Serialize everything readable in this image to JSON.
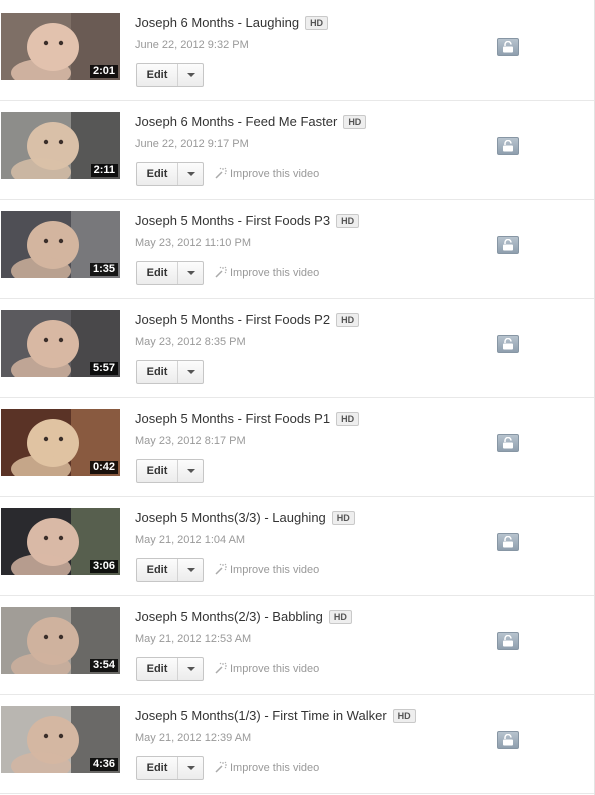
{
  "videos": [
    {
      "title": "Joseph 6 Months - Laughing",
      "hd": "HD",
      "date": "June 22, 2012 9:32 PM",
      "duration": "2:01",
      "edit_label": "Edit",
      "improve_label": "",
      "thumb_colors": {
        "bg": "#7e6f66",
        "fg": "#e2c2ae",
        "accent": "#5a4a45"
      },
      "privacy_icon": "unlock-icon"
    },
    {
      "title": "Joseph 6 Months - Feed Me Faster",
      "hd": "HD",
      "date": "June 22, 2012 9:17 PM",
      "duration": "2:11",
      "edit_label": "Edit",
      "improve_label": "Improve this video",
      "thumb_colors": {
        "bg": "#8d8d8a",
        "fg": "#d9c0a8",
        "accent": "#2b2b2b"
      },
      "privacy_icon": "unlock-icon"
    },
    {
      "title": "Joseph 5 Months - First Foods P3",
      "hd": "HD",
      "date": "May 23, 2012 11:10 PM",
      "duration": "1:35",
      "edit_label": "Edit",
      "improve_label": "Improve this video",
      "thumb_colors": {
        "bg": "#4f4f55",
        "fg": "#d3b59f",
        "accent": "#9a9a9a"
      },
      "privacy_icon": "unlock-icon"
    },
    {
      "title": "Joseph 5 Months - First Foods P2",
      "hd": "HD",
      "date": "May 23, 2012 8:35 PM",
      "duration": "5:57",
      "edit_label": "Edit",
      "improve_label": "",
      "thumb_colors": {
        "bg": "#5b5a5e",
        "fg": "#d8b8a3",
        "accent": "#3a3a3a"
      },
      "privacy_icon": "unlock-icon"
    },
    {
      "title": "Joseph 5 Months - First Foods P1",
      "hd": "HD",
      "date": "May 23, 2012 8:17 PM",
      "duration": "0:42",
      "edit_label": "Edit",
      "improve_label": "",
      "thumb_colors": {
        "bg": "#5a3326",
        "fg": "#e0c3a2",
        "accent": "#b07a55"
      },
      "privacy_icon": "unlock-icon"
    },
    {
      "title": "Joseph 5 Months(3/3) - Laughing",
      "hd": "HD",
      "date": "May 21, 2012 1:04 AM",
      "duration": "3:06",
      "edit_label": "Edit",
      "improve_label": "Improve this video",
      "thumb_colors": {
        "bg": "#2a2a2e",
        "fg": "#d9b9a6",
        "accent": "#7b8a6a"
      },
      "privacy_icon": "unlock-icon"
    },
    {
      "title": "Joseph 5 Months(2/3) - Babbling",
      "hd": "HD",
      "date": "May 21, 2012 12:53 AM",
      "duration": "3:54",
      "edit_label": "Edit",
      "improve_label": "Improve this video",
      "thumb_colors": {
        "bg": "#a19d97",
        "fg": "#cfb29e",
        "accent": "#3e3e3e"
      },
      "privacy_icon": "unlock-icon"
    },
    {
      "title": "Joseph 5 Months(1/3) - First Time in Walker",
      "hd": "HD",
      "date": "May 21, 2012 12:39 AM",
      "duration": "4:36",
      "edit_label": "Edit",
      "improve_label": "Improve this video",
      "thumb_colors": {
        "bg": "#b9b6b1",
        "fg": "#d4b7a2",
        "accent": "#2a2a2a"
      },
      "privacy_icon": "unlock-icon"
    }
  ]
}
